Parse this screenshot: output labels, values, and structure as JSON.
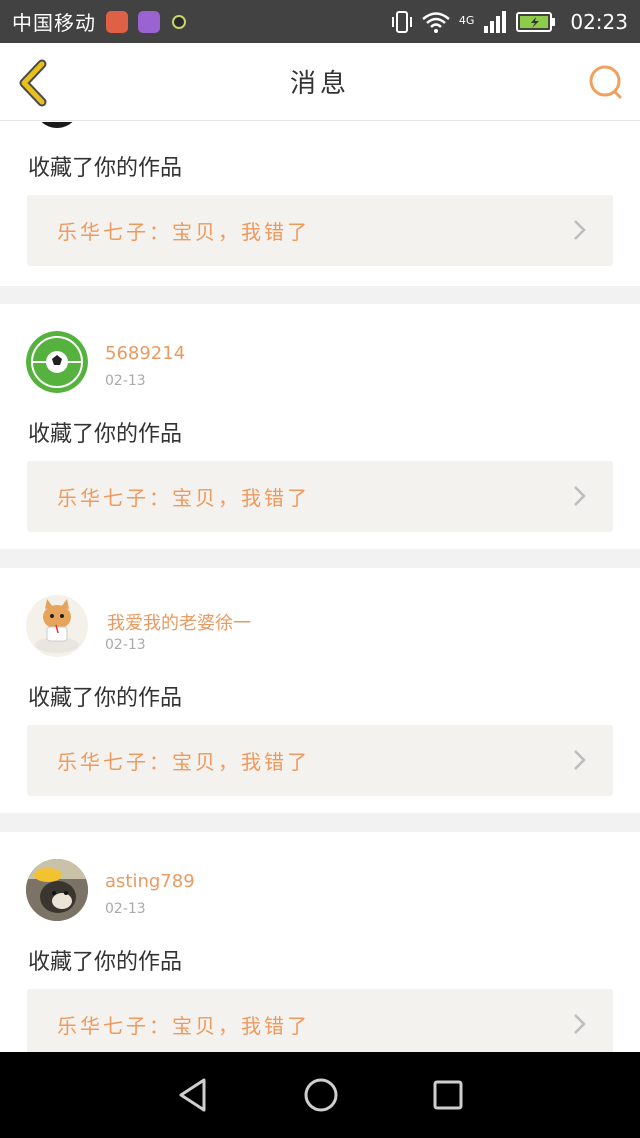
{
  "status_bar": {
    "carrier": "中国移动",
    "network": "4G",
    "time": "02:23"
  },
  "header": {
    "title": "消息",
    "back_icon": "chevron-left-icon",
    "search_icon": "search-icon"
  },
  "colors": {
    "accent": "#ea9a60",
    "back_chevron": "#e8c01e",
    "box_bg": "#f3f2ee"
  },
  "messages": [
    {
      "action": "收藏了你的作品",
      "work_title": "乐华七子：宝贝，我错了"
    },
    {
      "username": "5689214",
      "date": "02-13",
      "avatar": "soccer-ball-avatar",
      "action": "收藏了你的作品",
      "work_title": "乐华七子：宝贝，我错了"
    },
    {
      "username": "我爱我的老婆徐一",
      "date": "02-13",
      "avatar": "cat-drinking-avatar",
      "action": "收藏了你的作品",
      "work_title": "乐华七子：宝贝，我错了"
    },
    {
      "username": "asting789",
      "date": "02-13",
      "avatar": "dog-photo-avatar",
      "action": "收藏了你的作品",
      "work_title": "乐华七子：宝贝，我错了"
    }
  ]
}
